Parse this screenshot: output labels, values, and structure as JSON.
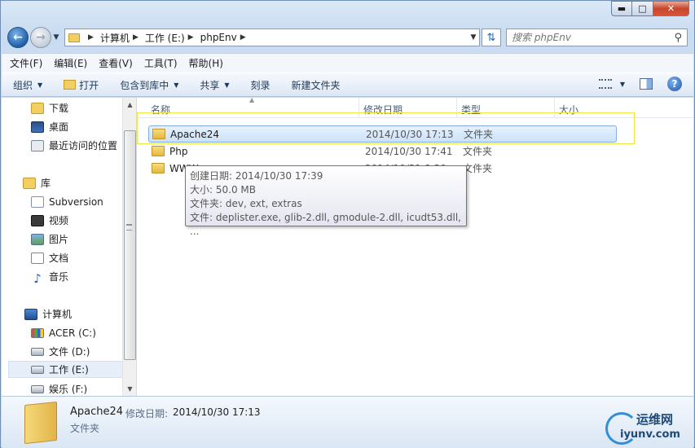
{
  "address": {
    "crumbs": [
      "计算机",
      "工作 (E:)",
      "phpEnv"
    ]
  },
  "search": {
    "placeholder": "搜索 phpEnv"
  },
  "menu": [
    "文件(F)",
    "编辑(E)",
    "查看(V)",
    "工具(T)",
    "帮助(H)"
  ],
  "toolbar": {
    "organize": "组织",
    "open": "打开",
    "include_library": "包含到库中",
    "share": "共享",
    "burn": "刻录",
    "new_folder": "新建文件夹"
  },
  "nav": {
    "favorites": [
      {
        "label": "下载",
        "icon": "downloads-folder-icon"
      },
      {
        "label": "桌面",
        "icon": "desktop-icon"
      },
      {
        "label": "最近访问的位置",
        "icon": "recent-places-icon"
      }
    ],
    "library_header": "库",
    "libraries": [
      {
        "label": "Subversion",
        "icon": "subversion-library-icon"
      },
      {
        "label": "视频",
        "icon": "video-library-icon"
      },
      {
        "label": "图片",
        "icon": "picture-library-icon"
      },
      {
        "label": "文档",
        "icon": "document-library-icon"
      },
      {
        "label": "音乐",
        "icon": "music-library-icon"
      }
    ],
    "computer_header": "计算机",
    "drives": [
      {
        "label": "ACER (C:)",
        "icon": "windows-drive-icon"
      },
      {
        "label": "文件 (D:)",
        "icon": "drive-icon"
      },
      {
        "label": "工作 (E:)",
        "icon": "drive-icon",
        "selected": true
      },
      {
        "label": "娱乐 (F:)",
        "icon": "drive-icon"
      }
    ]
  },
  "columns": [
    "名称",
    "修改日期",
    "类型",
    "大小"
  ],
  "files": [
    {
      "name": "Apache24",
      "date": "2014/10/30 17:13",
      "type": "文件夹",
      "selected": true
    },
    {
      "name": "Php",
      "date": "2014/10/30 17:41",
      "type": "文件夹"
    },
    {
      "name": "WWW",
      "date": "2014/10/31 8:30",
      "type": "文件夹"
    }
  ],
  "tooltip": {
    "line1": "创建日期: 2014/10/30 17:39",
    "line2": "大小: 50.0 MB",
    "line3": "文件夹: dev, ext, extras",
    "line4": "文件: deplister.exe, glib-2.dll, gmodule-2.dll, icudt53.dll, ..."
  },
  "details": {
    "name": "Apache24",
    "modified_label": "修改日期:",
    "modified": "2014/10/30 17:13",
    "type": "文件夹"
  },
  "watermark": {
    "cn": "运维网",
    "url": "iyunv.com"
  }
}
